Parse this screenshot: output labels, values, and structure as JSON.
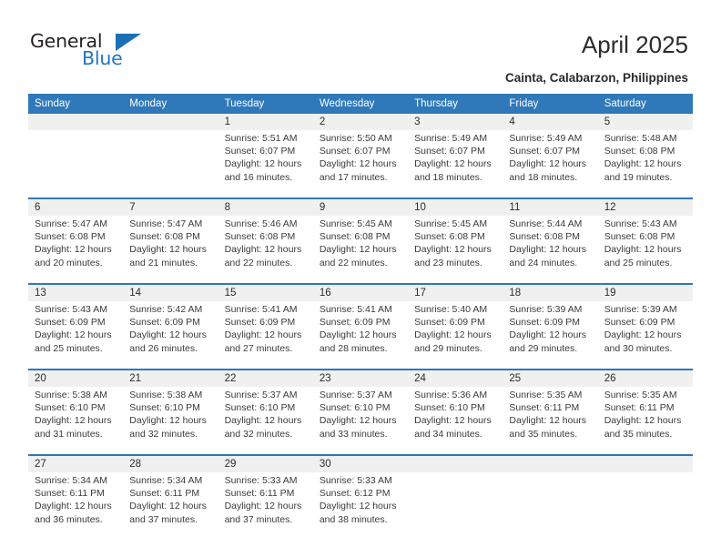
{
  "brand": {
    "name_part1": "General",
    "name_part2": "Blue",
    "flag_icon": "triangle-flag-icon",
    "accent_color": "#2077bd"
  },
  "header": {
    "title": "April 2025",
    "location": "Cainta, Calabarzon, Philippines"
  },
  "theme": {
    "header_blue": "#2f78b9",
    "daynum_band": "#f0f0f0",
    "text": "#2b2b2b"
  },
  "calendar": {
    "weekday_headers": [
      "Sunday",
      "Monday",
      "Tuesday",
      "Wednesday",
      "Thursday",
      "Friday",
      "Saturday"
    ],
    "weeks": [
      {
        "days": [
          {
            "date": "",
            "empty": true
          },
          {
            "date": "",
            "empty": true
          },
          {
            "date": "1",
            "sunrise": "Sunrise: 5:51 AM",
            "sunset": "Sunset: 6:07 PM",
            "daylight1": "Daylight: 12 hours",
            "daylight2": "and 16 minutes."
          },
          {
            "date": "2",
            "sunrise": "Sunrise: 5:50 AM",
            "sunset": "Sunset: 6:07 PM",
            "daylight1": "Daylight: 12 hours",
            "daylight2": "and 17 minutes."
          },
          {
            "date": "3",
            "sunrise": "Sunrise: 5:49 AM",
            "sunset": "Sunset: 6:07 PM",
            "daylight1": "Daylight: 12 hours",
            "daylight2": "and 18 minutes."
          },
          {
            "date": "4",
            "sunrise": "Sunrise: 5:49 AM",
            "sunset": "Sunset: 6:07 PM",
            "daylight1": "Daylight: 12 hours",
            "daylight2": "and 18 minutes."
          },
          {
            "date": "5",
            "sunrise": "Sunrise: 5:48 AM",
            "sunset": "Sunset: 6:08 PM",
            "daylight1": "Daylight: 12 hours",
            "daylight2": "and 19 minutes."
          }
        ]
      },
      {
        "days": [
          {
            "date": "6",
            "sunrise": "Sunrise: 5:47 AM",
            "sunset": "Sunset: 6:08 PM",
            "daylight1": "Daylight: 12 hours",
            "daylight2": "and 20 minutes."
          },
          {
            "date": "7",
            "sunrise": "Sunrise: 5:47 AM",
            "sunset": "Sunset: 6:08 PM",
            "daylight1": "Daylight: 12 hours",
            "daylight2": "and 21 minutes."
          },
          {
            "date": "8",
            "sunrise": "Sunrise: 5:46 AM",
            "sunset": "Sunset: 6:08 PM",
            "daylight1": "Daylight: 12 hours",
            "daylight2": "and 22 minutes."
          },
          {
            "date": "9",
            "sunrise": "Sunrise: 5:45 AM",
            "sunset": "Sunset: 6:08 PM",
            "daylight1": "Daylight: 12 hours",
            "daylight2": "and 22 minutes."
          },
          {
            "date": "10",
            "sunrise": "Sunrise: 5:45 AM",
            "sunset": "Sunset: 6:08 PM",
            "daylight1": "Daylight: 12 hours",
            "daylight2": "and 23 minutes."
          },
          {
            "date": "11",
            "sunrise": "Sunrise: 5:44 AM",
            "sunset": "Sunset: 6:08 PM",
            "daylight1": "Daylight: 12 hours",
            "daylight2": "and 24 minutes."
          },
          {
            "date": "12",
            "sunrise": "Sunrise: 5:43 AM",
            "sunset": "Sunset: 6:08 PM",
            "daylight1": "Daylight: 12 hours",
            "daylight2": "and 25 minutes."
          }
        ]
      },
      {
        "days": [
          {
            "date": "13",
            "sunrise": "Sunrise: 5:43 AM",
            "sunset": "Sunset: 6:09 PM",
            "daylight1": "Daylight: 12 hours",
            "daylight2": "and 25 minutes."
          },
          {
            "date": "14",
            "sunrise": "Sunrise: 5:42 AM",
            "sunset": "Sunset: 6:09 PM",
            "daylight1": "Daylight: 12 hours",
            "daylight2": "and 26 minutes."
          },
          {
            "date": "15",
            "sunrise": "Sunrise: 5:41 AM",
            "sunset": "Sunset: 6:09 PM",
            "daylight1": "Daylight: 12 hours",
            "daylight2": "and 27 minutes."
          },
          {
            "date": "16",
            "sunrise": "Sunrise: 5:41 AM",
            "sunset": "Sunset: 6:09 PM",
            "daylight1": "Daylight: 12 hours",
            "daylight2": "and 28 minutes."
          },
          {
            "date": "17",
            "sunrise": "Sunrise: 5:40 AM",
            "sunset": "Sunset: 6:09 PM",
            "daylight1": "Daylight: 12 hours",
            "daylight2": "and 29 minutes."
          },
          {
            "date": "18",
            "sunrise": "Sunrise: 5:39 AM",
            "sunset": "Sunset: 6:09 PM",
            "daylight1": "Daylight: 12 hours",
            "daylight2": "and 29 minutes."
          },
          {
            "date": "19",
            "sunrise": "Sunrise: 5:39 AM",
            "sunset": "Sunset: 6:09 PM",
            "daylight1": "Daylight: 12 hours",
            "daylight2": "and 30 minutes."
          }
        ]
      },
      {
        "days": [
          {
            "date": "20",
            "sunrise": "Sunrise: 5:38 AM",
            "sunset": "Sunset: 6:10 PM",
            "daylight1": "Daylight: 12 hours",
            "daylight2": "and 31 minutes."
          },
          {
            "date": "21",
            "sunrise": "Sunrise: 5:38 AM",
            "sunset": "Sunset: 6:10 PM",
            "daylight1": "Daylight: 12 hours",
            "daylight2": "and 32 minutes."
          },
          {
            "date": "22",
            "sunrise": "Sunrise: 5:37 AM",
            "sunset": "Sunset: 6:10 PM",
            "daylight1": "Daylight: 12 hours",
            "daylight2": "and 32 minutes."
          },
          {
            "date": "23",
            "sunrise": "Sunrise: 5:37 AM",
            "sunset": "Sunset: 6:10 PM",
            "daylight1": "Daylight: 12 hours",
            "daylight2": "and 33 minutes."
          },
          {
            "date": "24",
            "sunrise": "Sunrise: 5:36 AM",
            "sunset": "Sunset: 6:10 PM",
            "daylight1": "Daylight: 12 hours",
            "daylight2": "and 34 minutes."
          },
          {
            "date": "25",
            "sunrise": "Sunrise: 5:35 AM",
            "sunset": "Sunset: 6:11 PM",
            "daylight1": "Daylight: 12 hours",
            "daylight2": "and 35 minutes."
          },
          {
            "date": "26",
            "sunrise": "Sunrise: 5:35 AM",
            "sunset": "Sunset: 6:11 PM",
            "daylight1": "Daylight: 12 hours",
            "daylight2": "and 35 minutes."
          }
        ]
      },
      {
        "days": [
          {
            "date": "27",
            "sunrise": "Sunrise: 5:34 AM",
            "sunset": "Sunset: 6:11 PM",
            "daylight1": "Daylight: 12 hours",
            "daylight2": "and 36 minutes."
          },
          {
            "date": "28",
            "sunrise": "Sunrise: 5:34 AM",
            "sunset": "Sunset: 6:11 PM",
            "daylight1": "Daylight: 12 hours",
            "daylight2": "and 37 minutes."
          },
          {
            "date": "29",
            "sunrise": "Sunrise: 5:33 AM",
            "sunset": "Sunset: 6:11 PM",
            "daylight1": "Daylight: 12 hours",
            "daylight2": "and 37 minutes."
          },
          {
            "date": "30",
            "sunrise": "Sunrise: 5:33 AM",
            "sunset": "Sunset: 6:12 PM",
            "daylight1": "Daylight: 12 hours",
            "daylight2": "and 38 minutes."
          },
          {
            "date": "",
            "empty": true
          },
          {
            "date": "",
            "empty": true
          },
          {
            "date": "",
            "empty": true
          }
        ]
      }
    ]
  }
}
